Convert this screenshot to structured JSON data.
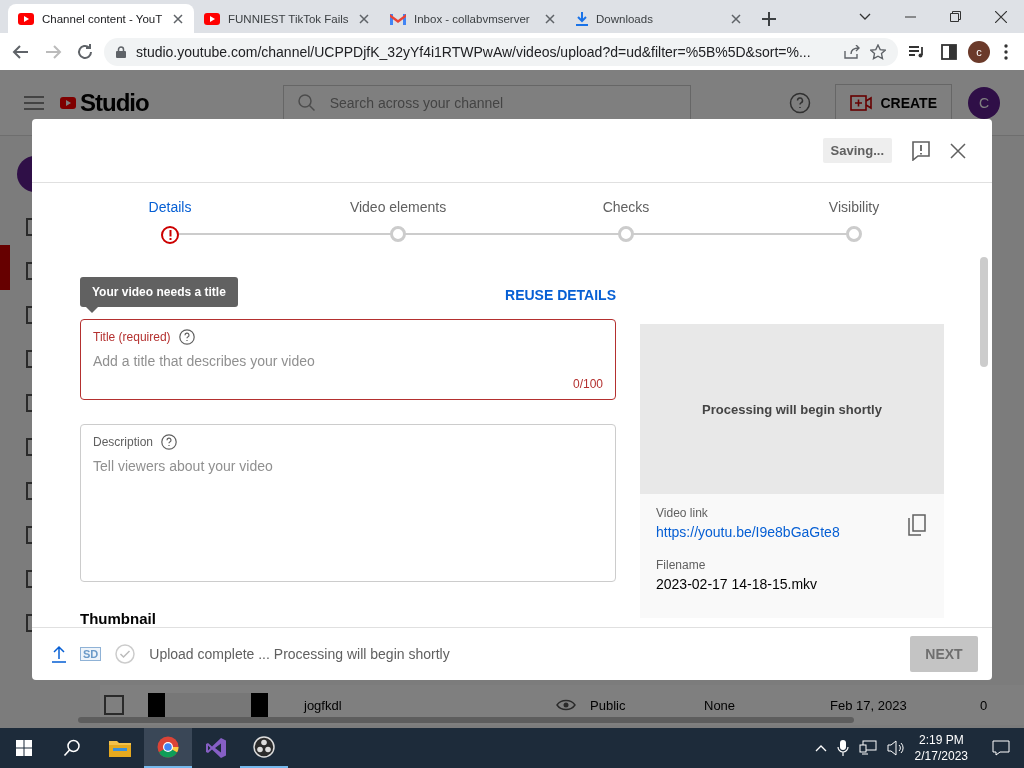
{
  "browser": {
    "tabs": [
      {
        "title": "Channel content - YouT",
        "selected": true,
        "kind": "youtube"
      },
      {
        "title": "FUNNIEST TikTok Fails",
        "selected": false,
        "kind": "youtube"
      },
      {
        "title": "Inbox - collabvmserver",
        "selected": false,
        "kind": "mail"
      },
      {
        "title": "Downloads",
        "selected": false,
        "kind": "download"
      }
    ],
    "address": "studio.youtube.com/channel/UCPPDjfK_32yYf4i1RTWPwAw/videos/upload?d=ud&filter=%5B%5D&sort=%...",
    "profile_initial": "c"
  },
  "studio": {
    "logo": "Studio",
    "search_placeholder": "Search across your channel",
    "create_label": "CREATE",
    "avatar_initial": "C",
    "row": {
      "checked": false,
      "title": "jogfkdl",
      "visibility": "Public",
      "restrictions": "None",
      "date": "Feb 17, 2023",
      "views": "0"
    }
  },
  "dialog": {
    "status": "Saving...",
    "steps": [
      {
        "label": "Details",
        "selected": true,
        "error": true
      },
      {
        "label": "Video elements",
        "selected": false,
        "error": false
      },
      {
        "label": "Checks",
        "selected": false,
        "error": false
      },
      {
        "label": "Visibility",
        "selected": false,
        "error": false
      }
    ],
    "reuse": "REUSE DETAILS",
    "tooltip": "Your video needs a title",
    "title_field": {
      "label": "Title (required)",
      "placeholder": "Add a title that describes your video",
      "counter": "0/100",
      "error": true
    },
    "description_field": {
      "label": "Description",
      "placeholder": "Tell viewers about your video"
    },
    "thumbnail_heading": "Thumbnail",
    "preview": {
      "message": "Processing will begin shortly",
      "link_label": "Video link",
      "link": "https://youtu.be/I9e8bGaGte8",
      "filename_label": "Filename",
      "filename": "2023-02-17 14-18-15.mkv"
    },
    "footer": {
      "quality": "SD",
      "status": "Upload complete ... Processing will begin shortly",
      "next": "NEXT",
      "next_disabled": true
    }
  },
  "taskbar": {
    "time": "2:19 PM",
    "date": "2/17/2023"
  }
}
